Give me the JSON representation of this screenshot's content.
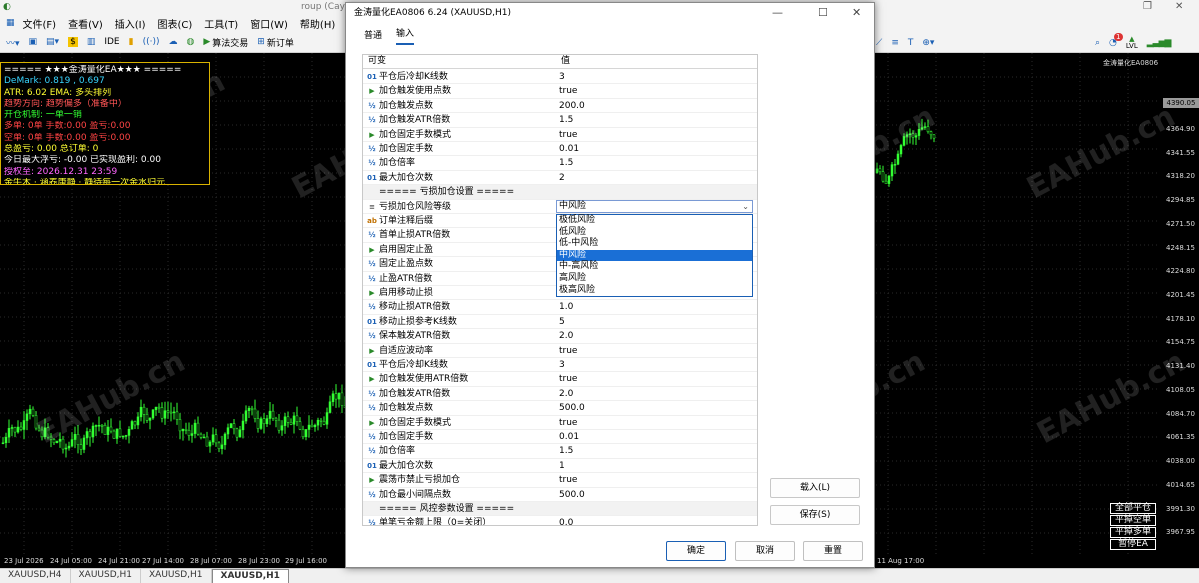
{
  "app": {
    "title_fragment": "roup (Caym"
  },
  "menu": [
    "文件(F)",
    "查看(V)",
    "插入(I)",
    "图表(C)",
    "工具(T)",
    "窗口(W)",
    "帮助(H)"
  ],
  "toolbar": {
    "ide": "IDE",
    "algo_trading": "算法交易",
    "new_order": "新订单",
    "lvl": "LVL",
    "badge": "1"
  },
  "chart": {
    "label": "金涛量化EA0806",
    "x_ticks": [
      "23 Jul 2026",
      "24 Jul 05:00",
      "24 Jul 21:00",
      "27 Jul 14:00",
      "28 Jul 07:00",
      "28 Jul 23:00",
      "29 Jul 16:00",
      "11 Aug 17:00"
    ],
    "y_ticks": [
      "4364.90",
      "4341.55",
      "4318.20",
      "4294.85",
      "4271.50",
      "4248.15",
      "4224.80",
      "4201.45",
      "4178.10",
      "4154.75",
      "4131.40",
      "4108.05",
      "4084.70",
      "4061.35",
      "4038.00",
      "4014.65",
      "3991.30",
      "3967.95"
    ],
    "price_tag": "4390.05",
    "watermark": "EAHub.cn",
    "side_buttons": [
      "全部平仓",
      "平掉空单",
      "平掉多单",
      "暂停EA"
    ]
  },
  "info_panel": [
    {
      "text": "===== ★★★金涛量化EA★★★ =====",
      "color": "#ffffff"
    },
    {
      "text": "DeMark: 0.819 , 0.697",
      "color": "#39d4ff"
    },
    {
      "text": "ATR: 6.02  EMA: 多头排列",
      "color": "#ffff33"
    },
    {
      "text": "趋势方向: 趋势偏多（准备中）",
      "color": "#ff5555"
    },
    {
      "text": "开仓机制: 一单一销",
      "color": "#33ff33"
    },
    {
      "text": "多单: 0单  手数:0.00  盈亏:0.00",
      "color": "#ff4444"
    },
    {
      "text": "空单: 0单  手数:0.00  盈亏:0.00",
      "color": "#ff4444"
    },
    {
      "text": "总盈亏: 0.00  总订单: 0",
      "color": "#ffff33"
    },
    {
      "text": "今日最大浮亏: -0.00  已实现盈利: 0.00",
      "color": "#ffffff"
    },
    {
      "text": "授权至: 2026.12.31 23:59",
      "color": "#ff66ff"
    },
    {
      "text": "金牛木 · 涵养康静 · 静待每一次金水归元",
      "color": "#ffff33"
    }
  ],
  "chart_tabs": [
    "XAUUSD,H4",
    "XAUUSD,H1",
    "XAUUSD,H1",
    "XAUUSD,H1"
  ],
  "dialog": {
    "title": "金涛量化EA0806 6.24 (XAUUSD,H1)",
    "tabs": [
      "普通",
      "输入"
    ],
    "col_variable": "可变",
    "col_value": "值",
    "rows": [
      {
        "icon": "01",
        "type": "int",
        "name": "平仓后冷却K线数",
        "value": "3"
      },
      {
        "icon": "▶",
        "type": "bool",
        "name": "加仓触发使用点数",
        "value": "true"
      },
      {
        "icon": "½",
        "type": "dbl",
        "name": "加仓触发点数",
        "value": "200.0"
      },
      {
        "icon": "½",
        "type": "dbl",
        "name": "加仓触发ATR倍数",
        "value": "1.5"
      },
      {
        "icon": "▶",
        "type": "bool",
        "name": "加仓固定手数模式",
        "value": "true"
      },
      {
        "icon": "½",
        "type": "dbl",
        "name": "加仓固定手数",
        "value": "0.01"
      },
      {
        "icon": "½",
        "type": "dbl",
        "name": "加仓倍率",
        "value": "1.5"
      },
      {
        "icon": "01",
        "type": "int",
        "name": "最大加仓次数",
        "value": "2"
      },
      {
        "icon": "",
        "type": "sep",
        "name": "===== 亏损加仓设置 =====",
        "value": ""
      },
      {
        "icon": "≡",
        "type": "enum",
        "name": "亏损加仓风险等级",
        "value": ""
      },
      {
        "icon": "ab",
        "type": "str",
        "name": "订单注释后缀",
        "value": ""
      },
      {
        "icon": "½",
        "type": "dbl",
        "name": "首单止损ATR倍数",
        "value": ""
      },
      {
        "icon": "▶",
        "type": "bool",
        "name": "启用固定止盈",
        "value": ""
      },
      {
        "icon": "½",
        "type": "dbl",
        "name": "固定止盈点数",
        "value": ""
      },
      {
        "icon": "½",
        "type": "dbl",
        "name": "止盈ATR倍数",
        "value": ""
      },
      {
        "icon": "▶",
        "type": "bool",
        "name": "启用移动止损",
        "value": ""
      },
      {
        "icon": "½",
        "type": "dbl",
        "name": "移动止损ATR倍数",
        "value": "1.0"
      },
      {
        "icon": "01",
        "type": "int",
        "name": "移动止损参考K线数",
        "value": "5"
      },
      {
        "icon": "½",
        "type": "dbl",
        "name": "保本触发ATR倍数",
        "value": "2.0"
      },
      {
        "icon": "▶",
        "type": "bool",
        "name": "自适应波动率",
        "value": "true"
      },
      {
        "icon": "01",
        "type": "int",
        "name": "平仓后冷却K线数",
        "value": "3"
      },
      {
        "icon": "▶",
        "type": "bool",
        "name": "加仓触发使用ATR倍数",
        "value": "true"
      },
      {
        "icon": "½",
        "type": "dbl",
        "name": "加仓触发ATR倍数",
        "value": "2.0"
      },
      {
        "icon": "½",
        "type": "dbl",
        "name": "加仓触发点数",
        "value": "500.0"
      },
      {
        "icon": "▶",
        "type": "bool",
        "name": "加仓固定手数模式",
        "value": "true"
      },
      {
        "icon": "½",
        "type": "dbl",
        "name": "加仓固定手数",
        "value": "0.01"
      },
      {
        "icon": "½",
        "type": "dbl",
        "name": "加仓倍率",
        "value": "1.5"
      },
      {
        "icon": "01",
        "type": "int",
        "name": "最大加仓次数",
        "value": "1"
      },
      {
        "icon": "▶",
        "type": "bool",
        "name": "震荡市禁止亏损加仓",
        "value": "true"
      },
      {
        "icon": "½",
        "type": "dbl",
        "name": "加仓最小间隔点数",
        "value": "500.0"
      },
      {
        "icon": "",
        "type": "sep",
        "name": "===== 风控参数设置 =====",
        "value": ""
      },
      {
        "icon": "½",
        "type": "dbl",
        "name": "单笔亏金额上限（0=关闭）",
        "value": "0.0"
      }
    ],
    "combo_value": "中风险",
    "dropdown_options": [
      "极低风险",
      "低风险",
      "低-中风险",
      "中风险",
      "中-高风险",
      "高风险",
      "极高风险"
    ],
    "dropdown_selected_index": 3,
    "load_button": "载入(L)",
    "save_button": "保存(S)",
    "ok_button": "确定",
    "cancel_button": "取消",
    "reset_button": "重置"
  }
}
